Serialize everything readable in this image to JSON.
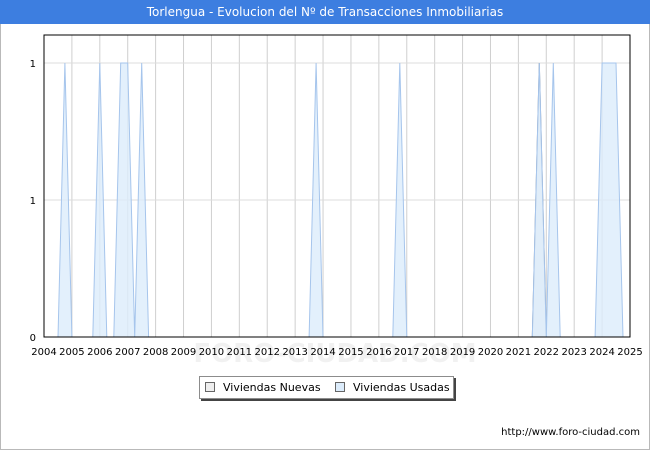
{
  "title": "Torlengua - Evolucion del Nº de Transacciones Inmobiliarias",
  "footer_url": "http://www.foro-ciudad.com",
  "watermark": "FORO-CIUDAD.COM",
  "chart_data": {
    "type": "area",
    "title": "Torlengua - Evolucion del Nº de Transacciones Inmobiliarias",
    "xlabel": "",
    "ylabel": "",
    "x_ticks": [
      "2004",
      "2005",
      "2006",
      "2007",
      "2008",
      "2009",
      "2010",
      "2011",
      "2012",
      "2013",
      "2014",
      "2015",
      "2016",
      "2017",
      "2018",
      "2019",
      "2020",
      "2021",
      "2022",
      "2023",
      "2024",
      "2025"
    ],
    "xlim": [
      2004,
      2025
    ],
    "ylim": [
      0,
      1
    ],
    "y_ticks": [
      0,
      0.5,
      1
    ],
    "y_tick_labels": [
      "0",
      "1",
      "1"
    ],
    "grid": true,
    "legend_position": "bottom-center",
    "series": [
      {
        "name": "Viviendas Nuevas",
        "color": "#888888",
        "fill": "#eeeeee",
        "points": [
          [
            2021.5,
            0
          ],
          [
            2021.75,
            1
          ],
          [
            2022.0,
            0
          ]
        ]
      },
      {
        "name": "Viviendas Usadas",
        "color": "#a6c5ec",
        "fill": "#dcecfb",
        "points": [
          [
            2004.5,
            0
          ],
          [
            2004.75,
            1
          ],
          [
            2005.0,
            0
          ],
          [
            2005.75,
            0
          ],
          [
            2006.0,
            1
          ],
          [
            2006.25,
            0
          ],
          [
            2006.5,
            0
          ],
          [
            2006.75,
            1
          ],
          [
            2007.0,
            1
          ],
          [
            2007.25,
            0
          ],
          [
            2007.25,
            0
          ],
          [
            2007.5,
            1
          ],
          [
            2007.75,
            0
          ],
          [
            2013.5,
            0
          ],
          [
            2013.75,
            1
          ],
          [
            2014.0,
            0
          ],
          [
            2016.5,
            0
          ],
          [
            2016.75,
            1
          ],
          [
            2017.0,
            0
          ],
          [
            2021.5,
            0
          ],
          [
            2021.75,
            1
          ],
          [
            2022.0,
            0
          ],
          [
            2022.0,
            0
          ],
          [
            2022.25,
            1
          ],
          [
            2022.5,
            0
          ],
          [
            2023.75,
            0
          ],
          [
            2024.0,
            1
          ],
          [
            2024.5,
            1
          ],
          [
            2024.75,
            0
          ]
        ]
      }
    ]
  },
  "legend": {
    "items": [
      {
        "label": "Viviendas Nuevas",
        "swatch": "#eeeeee"
      },
      {
        "label": "Viviendas Usadas",
        "swatch": "#dcecfb"
      }
    ]
  }
}
